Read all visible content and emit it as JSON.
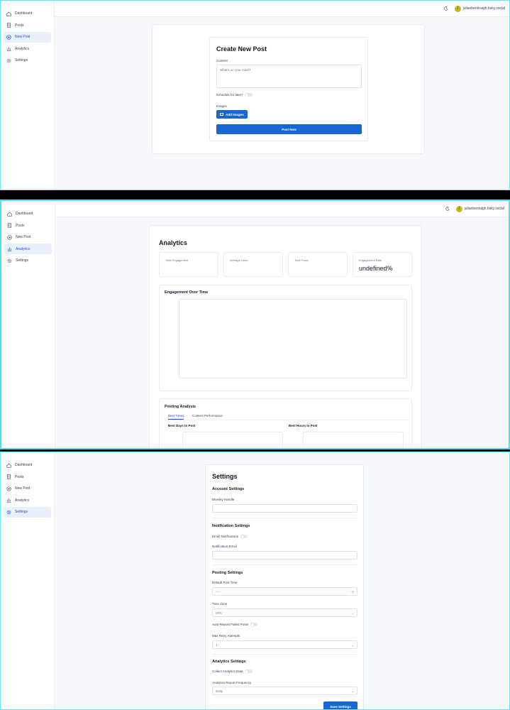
{
  "nav": {
    "dashboard": "Dashboard",
    "posts": "Posts",
    "new_post": "New Post",
    "analytics": "Analytics",
    "settings": "Settings"
  },
  "user": {
    "initial": "J",
    "handle": "julianbenbraigh.bsky.social",
    "handle_short": "julianbentaigh.bsky.social"
  },
  "create_post": {
    "title": "Create New Post",
    "content_label": "Content",
    "content_placeholder": "What's on your mind?",
    "schedule_label": "Schedule for later?",
    "images_label": "Images",
    "add_images": "Add Images",
    "post_now": "Post Now"
  },
  "analytics": {
    "title": "Analytics",
    "stats": [
      {
        "label": "Total Engagement",
        "value": ""
      },
      {
        "label": "Average Likes",
        "value": ""
      },
      {
        "label": "Total Posts",
        "value": ""
      },
      {
        "label": "Engagement Rate",
        "value": "undefined%"
      }
    ],
    "engagement_title": "Engagement Over Time",
    "posting_title": "Posting Analysis",
    "tabs": [
      "Best Times",
      "Content Performance"
    ],
    "best_days": "Best Days to Post",
    "best_hours": "Best Hours to Post"
  },
  "settings": {
    "title": "Settings",
    "account_section": "Account Settings",
    "bluesky_handle": "Bluesky Handle",
    "notification_section": "Notification Settings",
    "email_notifications": "Email Notifications",
    "notification_email": "Notification Email",
    "posting_section": "Posting Settings",
    "default_post_time": "Default Post Time",
    "default_post_time_value": "--:--",
    "time_zone": "Time Zone",
    "time_zone_value": "UTC",
    "auto_repost": "Auto-Repost Failed Posts",
    "max_retry": "Max Retry Attempts",
    "max_retry_value": "1",
    "analytics_section": "Analytics Settings",
    "collect_analytics": "Collect Analytics Data",
    "report_frequency": "Analytics Report Frequency",
    "report_frequency_value": "Daily",
    "save": "Save Settings"
  },
  "colors": {
    "primary": "#1766d1",
    "active_nav_bg": "#e8f1fb",
    "avatar": "#c3b923",
    "frame_border": "#4ee0ee"
  },
  "icons": [
    "dashboard-icon",
    "posts-icon",
    "plus-circle-icon",
    "chart-icon",
    "gear-icon",
    "moon-icon",
    "image-icon",
    "clock-icon",
    "chevron-down-icon"
  ]
}
